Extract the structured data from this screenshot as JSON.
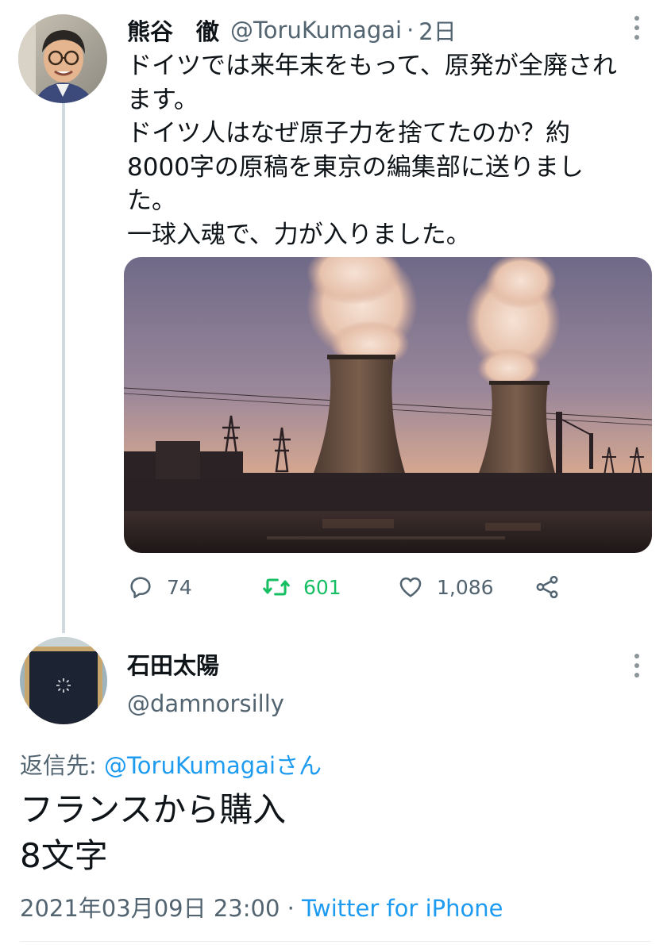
{
  "tweet": {
    "author_name": "熊谷　徹",
    "author_handle": "@ToruKumagai",
    "separator": "·",
    "time": "2日",
    "text_lines": [
      "ドイツでは来年末をもって、原発が全廃され",
      "ます。",
      "ドイツ人はなぜ原子力を捨てたのか？約",
      "8000字の原稿を東京の編集部に送りまし",
      "た。",
      "一球入魂で、力が入りました。"
    ],
    "media_icon": "cooling-towers-photo",
    "actions": {
      "replies": "74",
      "retweets": "601",
      "likes": "1,086"
    }
  },
  "reply": {
    "author_name": "石田太陽",
    "author_handle": "@damnorsilly",
    "reply_label": "返信先:",
    "reply_target": "@ToruKumagaiさん",
    "text_lines": [
      "フランスから購入",
      "8文字"
    ],
    "timestamp": "2021年03月09日 23:00",
    "separator": "·",
    "source": "Twitter for iPhone"
  },
  "colors": {
    "link": "#1d9bf0",
    "retweet": "#17bf63",
    "muted": "#536471"
  }
}
